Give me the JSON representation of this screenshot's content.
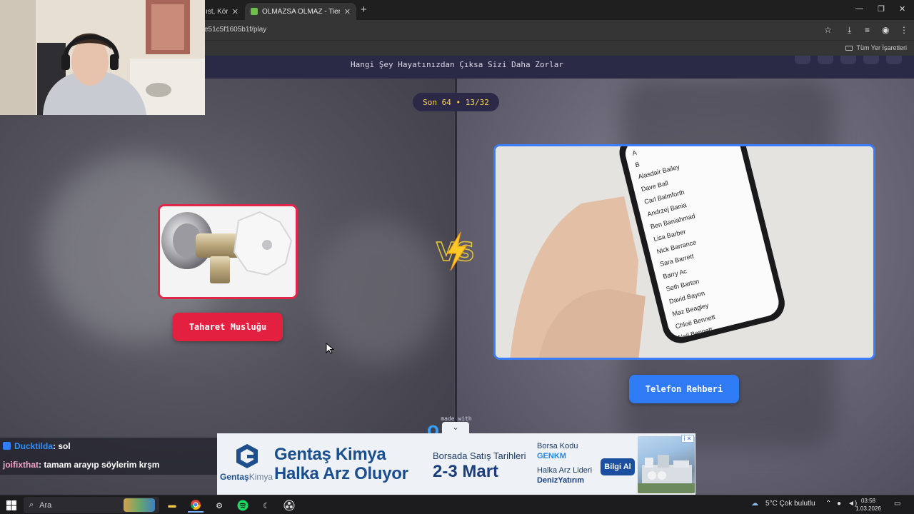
{
  "browser": {
    "tabs": [
      {
        "title": "ıst, Kör S",
        "active": false
      },
      {
        "title": "OLMAZSA OLMAZ - Tier List, Kö",
        "active": true
      }
    ],
    "new_tab": "+",
    "url": "e51c5f1605b1f/play",
    "bookmarks_label": "Tüm Yer İşaretleri",
    "window_controls": {
      "minimize": "—",
      "restore": "❐",
      "close": "✕"
    }
  },
  "page": {
    "title": "Hangi Şey Hayatınızdan Çıksa Sizi Daha Zorlar",
    "round": "Son 64 • 13/32",
    "left_option": {
      "label": "Taharet Musluğu",
      "accent": "#e3203f"
    },
    "right_option": {
      "label": "Telefon Rehberi",
      "accent": "#2f7bf5",
      "contact_sections": [
        "A",
        "B"
      ],
      "contacts": [
        "Alasdair Bailey",
        "Dave Ball",
        "Carl Balmforth",
        "Andrzej Bania",
        "Ben Baniahmad",
        "Lisa Barber",
        "Nick Barrance",
        "Sara Barrett",
        "Barry Ac",
        "Seth Barton",
        "David Bayon",
        "Maz Beagley",
        "Chloë Bennett",
        "Neil Bennett"
      ]
    },
    "made_with": "made with",
    "brand": "OKEI"
  },
  "ad": {
    "brand": "Gentaş",
    "brand_suffix": "Kimya",
    "headline_1": "Gentaş Kimya",
    "headline_2": "Halka Arz Oluyor",
    "borsa_label": "Borsada Satış Tarihleri",
    "dates": "2-3 Mart",
    "code_label": "Borsa Kodu",
    "code": "GENKM",
    "leader_label": "Halka Arz Lideri",
    "leader": "DenizYatırım",
    "cta": "Bilgi Al",
    "info_badge": "i ✕",
    "collapse": "⌄"
  },
  "chat": [
    {
      "user": "Ducktilda",
      "message": ": sol"
    },
    {
      "user": "joifixthat",
      "message": ": tamam arayıp söylerim krşm"
    }
  ],
  "taskbar": {
    "search_placeholder": "Ara",
    "weather": "5°C  Çok bulutlu",
    "time": "03:58",
    "date": "1.03.2026"
  }
}
